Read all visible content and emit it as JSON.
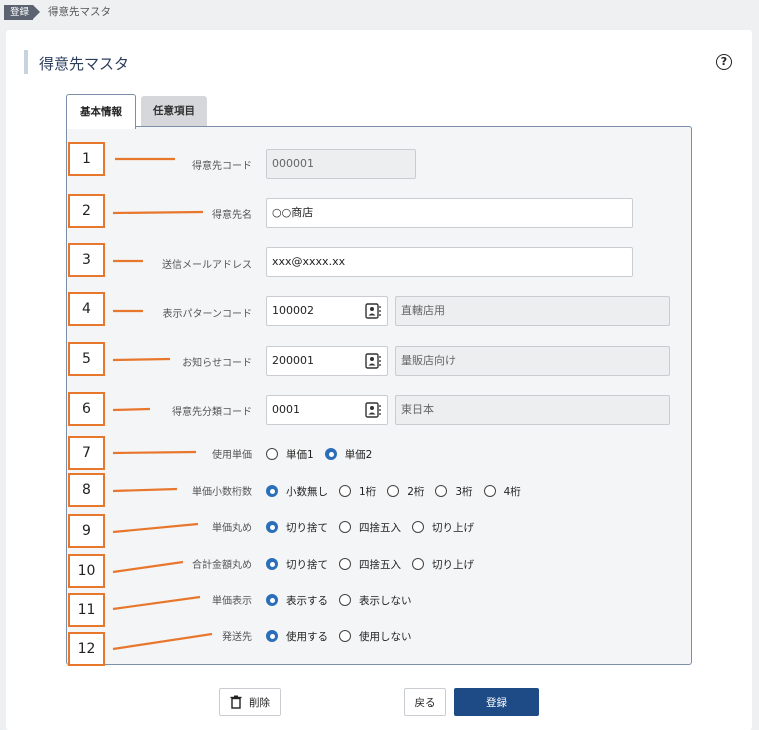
{
  "breadcrumb": {
    "tag": "登録",
    "current": "得意先マスタ"
  },
  "page": {
    "title": "得意先マスタ",
    "help_glyph": "?"
  },
  "tabs": [
    {
      "label": "基本情報",
      "active": true
    },
    {
      "label": "任意項目",
      "active": false
    }
  ],
  "annotations": [
    "1",
    "2",
    "3",
    "4",
    "5",
    "6",
    "7",
    "8",
    "9",
    "10",
    "11",
    "12"
  ],
  "fields": {
    "customer_code": {
      "label": "得意先コード",
      "value": "000001",
      "disabled": true
    },
    "customer_name": {
      "label": "得意先名",
      "value": "○○商店"
    },
    "email": {
      "label": "送信メールアドレス",
      "value": "xxx@xxxx.xx"
    },
    "pattern_code": {
      "label": "表示パターンコード",
      "value": "100002",
      "name": "直轄店用"
    },
    "notice_code": {
      "label": "お知らせコード",
      "value": "200001",
      "name": "量販店向け"
    },
    "category_code": {
      "label": "得意先分類コード",
      "value": "0001",
      "name": "東日本"
    }
  },
  "radios": {
    "unit_price": {
      "label": "使用単価",
      "options": [
        "単価1",
        "単価2"
      ],
      "selected": 1
    },
    "price_decimals": {
      "label": "単価小数桁数",
      "options": [
        "小数無し",
        "1桁",
        "2桁",
        "3桁",
        "4桁"
      ],
      "selected": 0
    },
    "price_rounding": {
      "label": "単価丸め",
      "options": [
        "切り捨て",
        "四捨五入",
        "切り上げ"
      ],
      "selected": 0
    },
    "total_rounding": {
      "label": "合計金額丸め",
      "options": [
        "切り捨て",
        "四捨五入",
        "切り上げ"
      ],
      "selected": 0
    },
    "price_display": {
      "label": "単価表示",
      "options": [
        "表示する",
        "表示しない"
      ],
      "selected": 0
    },
    "ship_to": {
      "label": "発送先",
      "options": [
        "使用する",
        "使用しない"
      ],
      "selected": 0
    }
  },
  "buttons": {
    "delete": "削除",
    "back": "戻る",
    "register": "登録"
  },
  "colors": {
    "accent": "#2a6fb8",
    "annotation": "#e8772e",
    "primary_button": "#1e4a85"
  }
}
